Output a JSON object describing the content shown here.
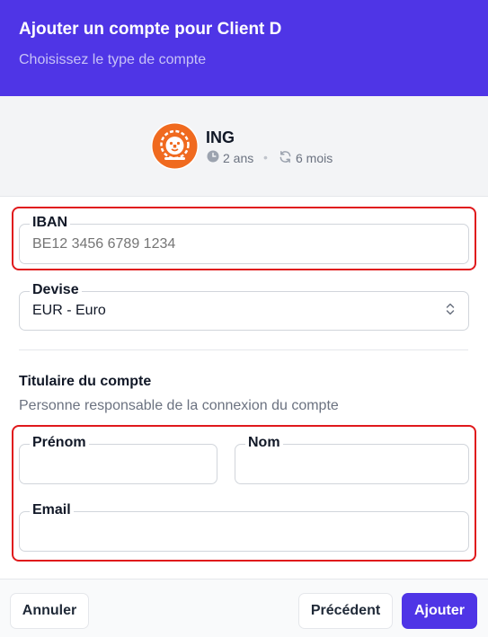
{
  "header": {
    "title": "Ajouter un compte pour Client D",
    "subtitle": "Choisissez le type de compte"
  },
  "bank": {
    "name": "ING",
    "age": "2 ans",
    "sync": "6 mois",
    "logo_color": "#f06a1f",
    "age_icon": "clock-icon",
    "sync_icon": "refresh-icon"
  },
  "form": {
    "iban": {
      "label": "IBAN",
      "value": "",
      "placeholder": "BE12 3456 6789 1234"
    },
    "currency": {
      "label": "Devise",
      "selected": "EUR - Euro"
    }
  },
  "holder": {
    "title": "Titulaire du compte",
    "subtitle": "Personne responsable de la connexion du compte",
    "first_name": {
      "label": "Prénom",
      "value": ""
    },
    "last_name": {
      "label": "Nom",
      "value": ""
    },
    "email": {
      "label": "Email",
      "value": ""
    }
  },
  "footer": {
    "cancel_label": "Annuler",
    "previous_label": "Précédent",
    "submit_label": "Ajouter"
  },
  "colors": {
    "accent": "#4f35e6",
    "highlight": "#e0191c"
  }
}
